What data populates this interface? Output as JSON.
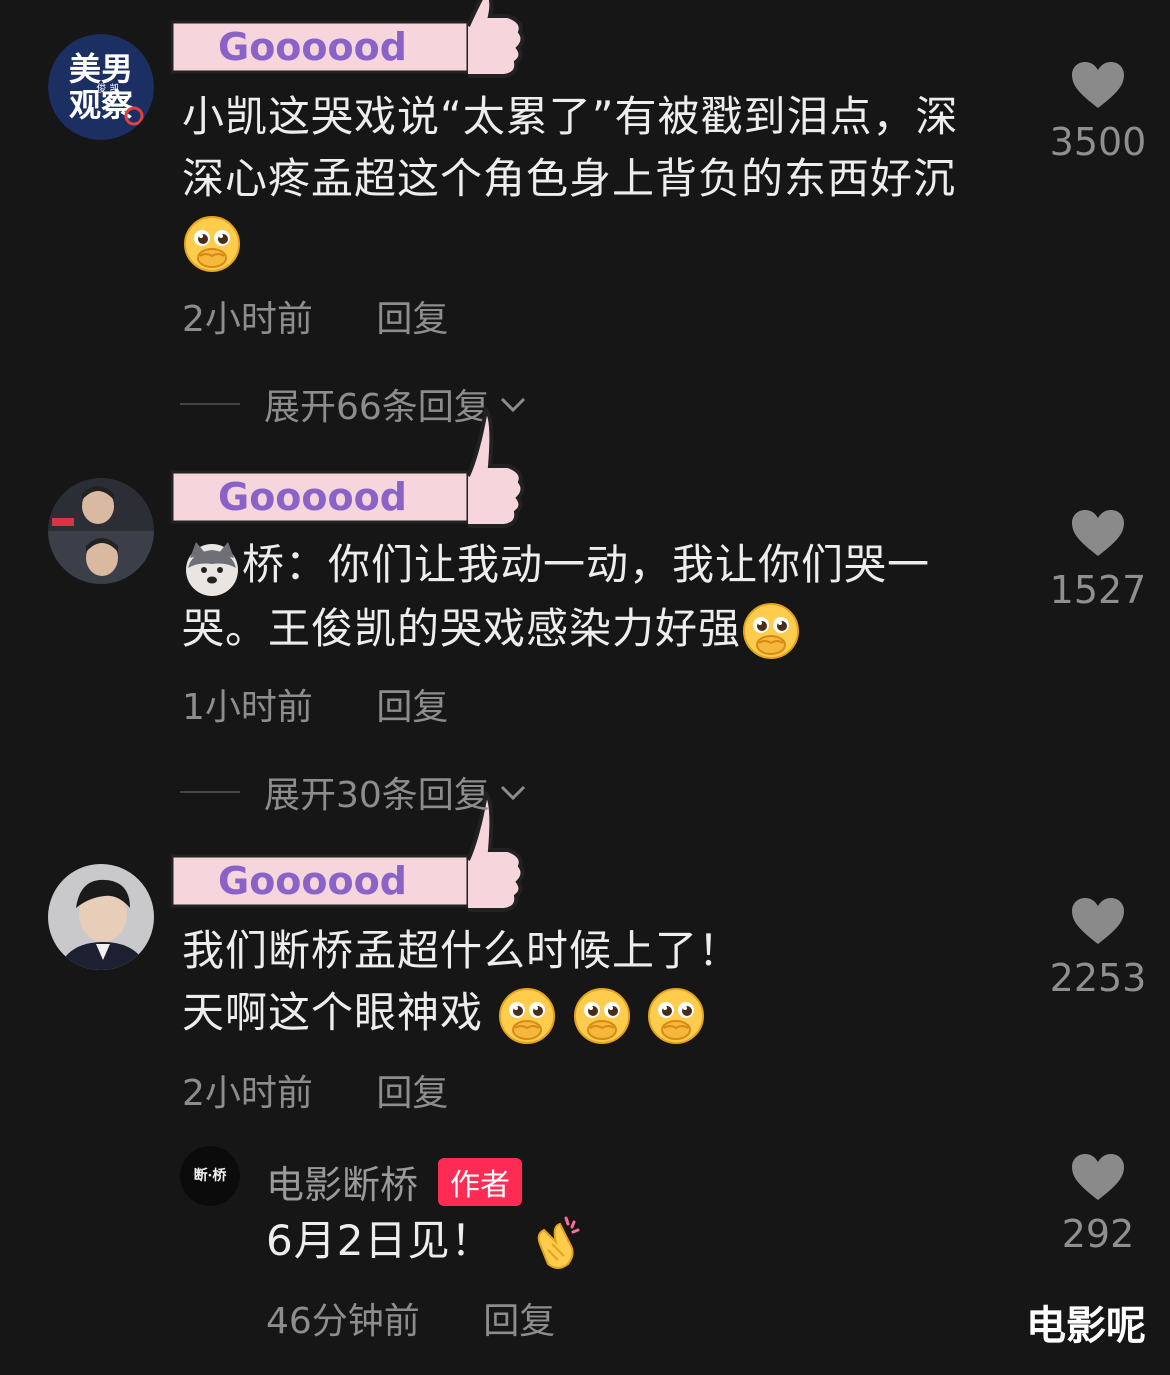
{
  "sticker_text": "Goooood",
  "comments": [
    {
      "avatar_text_top": "美男",
      "avatar_text_bottom": "观察",
      "avatar_text_small": "俊 凯",
      "text_line1": "小凯这哭戏说“太累了”有被戳到泪点，深",
      "text_line2": "深心疼孟超这个角色身上背负的东西好沉",
      "time": "2小时前",
      "reply": "回复",
      "likes": "3500",
      "expand": "展开66条回复"
    },
    {
      "text_prefix": "桥：你们让我动一动，我让你们哭一",
      "text_line2": "哭。王俊凯的哭戏感染力好强",
      "time": "1小时前",
      "reply": "回复",
      "likes": "1527",
      "expand": "展开30条回复"
    },
    {
      "text_line1": "我们断桥孟超什么时候上了！",
      "text_line2": "天啊这个眼神戏",
      "time": "2小时前",
      "reply": "回复",
      "likes": "2253"
    }
  ],
  "author_reply": {
    "avatar_text": "断·桥",
    "username": "电影断桥",
    "badge": "作者",
    "text": "6月2日见！",
    "time": "46分钟前",
    "reply": "回复",
    "likes": "292"
  },
  "watermark": "电影呢",
  "colors": {
    "background": "#161616",
    "badge": "#fe2c55",
    "sticker_fill": "#f6d6dc",
    "sticker_text": "#8a63c8"
  }
}
